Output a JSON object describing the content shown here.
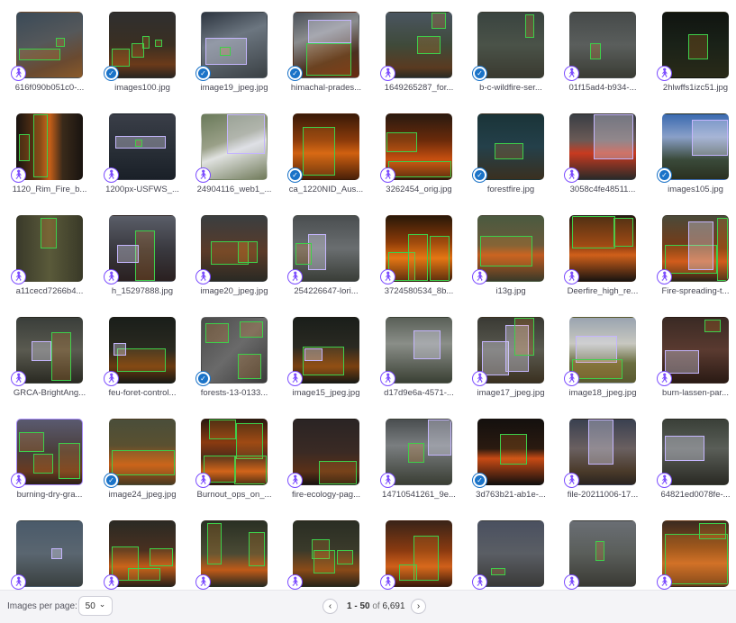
{
  "gallery": {
    "images": [
      {
        "name": "616f090b051c0-...",
        "badge": "person",
        "bg": "linear-gradient(160deg,#3a4a58,#55585a 45%,#6a4a30 75%,#8a5a2a)",
        "boxes": []
      },
      {
        "name": "images100.jpg",
        "badge": "shield",
        "bg": "linear-gradient(180deg,#2f2f2f,#3a2f22 50%,#6b3a1a 80%,#2a2520)",
        "boxes": []
      },
      {
        "name": "image19_jpeg.jpg",
        "badge": "shield",
        "bg": "linear-gradient(160deg,#2d3540,#6c7680 40%,#3a4044)",
        "boxes": []
      },
      {
        "name": "himachal-prades...",
        "badge": "shield",
        "bg": "linear-gradient(160deg,#4a5058,#8a8c8e 35%,#4a3020 70%,#6a2a10)",
        "boxes": []
      },
      {
        "name": "1649265287_for...",
        "badge": "person",
        "bg": "linear-gradient(180deg,#4a5560,#3f4a3a 50%,#5a3a20 85%,#2a2a22)",
        "boxes": []
      },
      {
        "name": "b-c-wildfire-ser...",
        "badge": "shield",
        "bg": "linear-gradient(180deg,#3a4440,#4a5248 50%,#3a3a30)",
        "boxes": []
      },
      {
        "name": "01f15ad4-b934-...",
        "badge": "person",
        "bg": "linear-gradient(180deg,#464a4a,#5a5e5c 50%,#3a3c34)",
        "boxes": []
      },
      {
        "name": "2hlwffs1izc51.jpg",
        "badge": "person",
        "bg": "linear-gradient(180deg,#101410,#1a2218 50%,#2a2a18)",
        "boxes": []
      },
      {
        "name": "1120_Rim_Fire_b...",
        "badge": "person",
        "bg": "linear-gradient(90deg,#1a1410,#6a3a14 35%,#c86018 50%,#3a2a1a 70%,#1a1410)",
        "boxes": []
      },
      {
        "name": "1200px-USFWS_...",
        "badge": "person",
        "bg": "linear-gradient(180deg,#3a3e48,#2a3038 50%,#1a2028)",
        "boxes": []
      },
      {
        "name": "24904116_web1_...",
        "badge": "person",
        "bg": "linear-gradient(160deg,#6a7a5a,#9aa088 40%,#e0e2e0 55%,#707a5a)",
        "boxes": []
      },
      {
        "name": "ca_1220NID_Aus...",
        "badge": "shield",
        "bg": "linear-gradient(180deg,#3a1a08,#8a3a0a 40%,#d06010 60%,#4a2008)",
        "boxes": []
      },
      {
        "name": "3262454_orig.jpg",
        "badge": "person",
        "bg": "linear-gradient(180deg,#2a1a10,#6a2a0a 40%,#c85010 70%,#3a1808)",
        "boxes": []
      },
      {
        "name": "forestfire.jpg",
        "badge": "shield",
        "bg": "linear-gradient(180deg,#1a3438,#24404a 50%,#3a3020)",
        "boxes": []
      },
      {
        "name": "3058c4fe48511...",
        "badge": "person",
        "bg": "linear-gradient(180deg,#3a3e44,#6a5a56 40%,#c83a20 60%,#2a2a28)",
        "boxes": []
      },
      {
        "name": "images105.jpg",
        "badge": "shield",
        "bg": "linear-gradient(180deg,#3a6ab0,#8aa0c8 35%,#3a4a3a 70%,#2a3020)",
        "boxes": []
      },
      {
        "name": "a11cecd7266b4...",
        "badge": "person",
        "bg": "linear-gradient(90deg,#3a3a2a,#5a5a3a 50%,#3a3a28)",
        "boxes": []
      },
      {
        "name": "h_15297888.jpg",
        "badge": "person",
        "bg": "linear-gradient(180deg,#5a5e68,#3a3a40 50%,#2a2020)",
        "boxes": []
      },
      {
        "name": "image20_jpeg.jpg",
        "badge": "person",
        "bg": "linear-gradient(180deg,#3a3e40,#5a3a28 55%,#2a2a24)",
        "boxes": []
      },
      {
        "name": "254226647-lori...",
        "badge": "person",
        "bg": "linear-gradient(180deg,#4a4e50,#6a6e70 50%,#3a3e38)",
        "boxes": []
      },
      {
        "name": "3724580534_8b...",
        "badge": "person",
        "bg": "linear-gradient(180deg,#2a1808,#8a3a08 40%,#e07010 65%,#3a1a08)",
        "boxes": []
      },
      {
        "name": "i13g.jpg",
        "badge": "person",
        "bg": "linear-gradient(180deg,#4a5a40,#6a5a3a 45%,#c05a20 60%,#3a3a28)",
        "boxes": []
      },
      {
        "name": "Deerfire_high_re...",
        "badge": "person",
        "bg": "linear-gradient(180deg,#2a1a10,#8a3a10 45%,#d0601a 60%,#1a1410)",
        "boxes": []
      },
      {
        "name": "Fire-spreading-t...",
        "badge": "person",
        "bg": "linear-gradient(180deg,#4a4a3a,#7a3a14 50%,#c8501a 70%,#2a2418)",
        "boxes": []
      },
      {
        "name": "GRCA-BrightAng...",
        "badge": "person",
        "bg": "linear-gradient(180deg,#3a3e3a,#5a5a50 50%,#2a2a22)",
        "boxes": []
      },
      {
        "name": "feu-foret-control...",
        "badge": "person",
        "bg": "linear-gradient(180deg,#1a1e1a,#2a2a20 50%,#6a3a10 75%,#1a1a14)",
        "boxes": []
      },
      {
        "name": "forests-13-0133...",
        "badge": "shield",
        "bg": "linear-gradient(135deg,#4a4a4a,#6a6a6a 50%,#3a3a3a)",
        "boxes": []
      },
      {
        "name": "image15_jpeg.jpg",
        "badge": "person",
        "bg": "linear-gradient(180deg,#1a1e1a,#2a2a22 45%,#7a4010 75%,#1a1a14)",
        "boxes": []
      },
      {
        "name": "d17d9e6a-4571-...",
        "badge": "person",
        "bg": "linear-gradient(180deg,#5a6058,#8a8e88 40%,#3a4034)",
        "boxes": []
      },
      {
        "name": "image17_jpeg.jpg",
        "badge": "person",
        "bg": "linear-gradient(180deg,#3a3a34,#5a5a50 50%,#3a3020)",
        "boxes": []
      },
      {
        "name": "image18_jpeg.jpg",
        "badge": "person",
        "bg": "linear-gradient(180deg,#9aa4b0,#c8c8c0 40%,#6a6e40 70%,#5a5a30)",
        "boxes": []
      },
      {
        "name": "burn-lassen-par...",
        "badge": "person",
        "bg": "linear-gradient(180deg,#3a2a24,#5a3a30 50%,#2a1a14)",
        "boxes": []
      },
      {
        "name": "burning-dry-gra...",
        "badge": "person",
        "bg": "linear-gradient(180deg,#5a5a70,#4a3e3a 50%,#6a3a20 80%,#2a2018)",
        "sel": true,
        "boxes": []
      },
      {
        "name": "image24_jpeg.jpg",
        "badge": "shield",
        "bg": "linear-gradient(180deg,#4a4e3a,#5a5030 40%,#c05a18 70%,#4a3a20)",
        "boxes": []
      },
      {
        "name": "Burnout_ops_on_...",
        "badge": "person",
        "bg": "linear-gradient(180deg,#2a1a10,#8a3a10 35%,#4a2a1a 60%,#c85a18 80%,#2a1a10)",
        "boxes": []
      },
      {
        "name": "fire-ecology-pag...",
        "badge": "person",
        "bg": "linear-gradient(180deg,#2a2424,#3a2a24 50%,#5a3018 80%,#1a1410)",
        "boxes": []
      },
      {
        "name": "14710541261_9e...",
        "badge": "person",
        "bg": "linear-gradient(180deg,#4a4e50,#7a7e80 40%,#3a3e34)",
        "boxes": []
      },
      {
        "name": "3d763b21-ab1e-...",
        "badge": "shield",
        "bg": "linear-gradient(180deg,#14100e,#2a1a10 45%,#c84a14 60%,#14100e)",
        "boxes": []
      },
      {
        "name": "file-20211006-17...",
        "badge": "person",
        "bg": "linear-gradient(180deg,#3a4050,#6a6060 45%,#4a3a2a 80%,#2a2420)",
        "boxes": []
      },
      {
        "name": "64821ed0078fe-...",
        "badge": "person",
        "bg": "linear-gradient(180deg,#3a4038,#5a5e58 45%,#2a2a24)",
        "boxes": []
      },
      {
        "name": "",
        "badge": "person",
        "bg": "linear-gradient(180deg,#4a5a6a,#5a6670 50%,#3a4040)",
        "boxes": []
      },
      {
        "name": "",
        "badge": "person",
        "bg": "linear-gradient(180deg,#2a2a24,#4a3020 45%,#c05a18 70%,#2a2018)",
        "boxes": []
      },
      {
        "name": "",
        "badge": "person",
        "bg": "linear-gradient(180deg,#2a3024,#4a4a34 50%,#c05a18 75%,#2a2a20)",
        "boxes": []
      },
      {
        "name": "",
        "badge": "person",
        "bg": "linear-gradient(180deg,#2a2e24,#3a3a2a 45%,#8a4a18 75%,#2a2418)",
        "boxes": []
      },
      {
        "name": "",
        "badge": "person",
        "bg": "linear-gradient(180deg,#3a2418,#8a3a10 45%,#d0601a 70%,#3a1a0a)",
        "boxes": []
      },
      {
        "name": "",
        "badge": "person",
        "bg": "linear-gradient(180deg,#4a5060,#5a5e64 50%,#3a3a38)",
        "boxes": []
      },
      {
        "name": "",
        "badge": "person",
        "bg": "linear-gradient(180deg,#6a6e74,#5a5e5a 50%,#3a3a34)",
        "boxes": []
      },
      {
        "name": "",
        "badge": "person",
        "bg": "linear-gradient(180deg,#3a2a20,#8a4a1a 40%,#c86a28 65%,#6a3a18)",
        "boxes": []
      }
    ]
  },
  "footer": {
    "images_per_page_label": "Images per page:",
    "images_per_page_value": "50",
    "range_text": "1 - 50",
    "of_text": "of",
    "total_text": "6,691",
    "prev_icon": "‹",
    "next_icon": "›",
    "dropdown_icon": "⌄"
  }
}
